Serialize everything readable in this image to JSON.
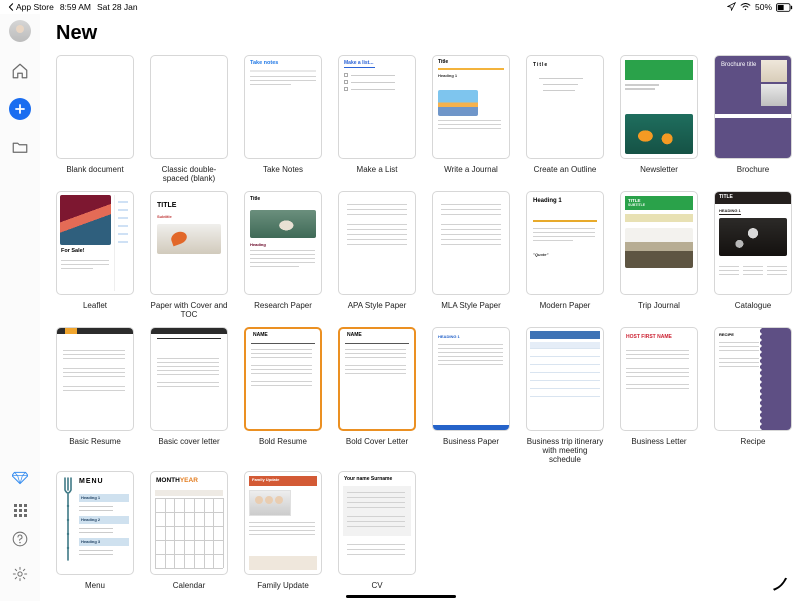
{
  "status": {
    "backApp": "App Store",
    "time": "8:59 AM",
    "date": "Sat 28 Jan",
    "batteryPct": "50%"
  },
  "page": {
    "title": "New"
  },
  "templates": [
    {
      "label": "Blank document"
    },
    {
      "label": "Classic double-spaced (blank)"
    },
    {
      "label": "Take Notes"
    },
    {
      "label": "Make a List"
    },
    {
      "label": "Write a Journal"
    },
    {
      "label": "Create an Outline"
    },
    {
      "label": "Newsletter"
    },
    {
      "label": "Brochure"
    },
    {
      "label": "Leaflet"
    },
    {
      "label": "Paper with Cover and TOC"
    },
    {
      "label": "Research Paper"
    },
    {
      "label": "APA Style Paper"
    },
    {
      "label": "MLA Style Paper"
    },
    {
      "label": "Modern Paper"
    },
    {
      "label": "Trip Journal"
    },
    {
      "label": "Catalogue"
    },
    {
      "label": "Basic Resume"
    },
    {
      "label": "Basic cover letter"
    },
    {
      "label": "Bold Resume"
    },
    {
      "label": "Bold Cover Letter"
    },
    {
      "label": "Business Paper"
    },
    {
      "label": "Business trip itinerary with meeting schedule"
    },
    {
      "label": "Business Letter"
    },
    {
      "label": "Recipe"
    },
    {
      "label": "Menu"
    },
    {
      "label": "Calendar"
    },
    {
      "label": "Family Update"
    },
    {
      "label": "CV"
    }
  ],
  "thumbText": {
    "takeNotes": "Take notes",
    "makeList": "Make a list...",
    "journalTitle": "Title",
    "journalHeading": "Heading 1",
    "outline": "Title",
    "brochure": "Brochure title",
    "leaflet": "For Sale!",
    "coverTitle": "TITLE",
    "coverSubtitle": "Subtitle",
    "researchTitle": "Title",
    "researchHeading": "Heading",
    "modernTitle": "Heading 1",
    "modernQuote": "\"Quote\"",
    "tripTitle": "TITLE",
    "tripSub": "SUBTITLE",
    "catalogueTitle": "TITLE",
    "catalogueHeading": "HEADING 1",
    "boldName": "NAME",
    "bpaperHeading": "HEADING 1",
    "bletterName": "HOST FIRST NAME",
    "recipeTitle": "RECIPE",
    "menuTitle": "MENU",
    "menuSec1": "Heading 1",
    "menuSec2": "Heading 2",
    "menuSec3": "Heading 3",
    "calMonth": "MONTH",
    "calYear": "YEAR",
    "family": "Family Update",
    "cvFirst": "Your name",
    "cvLast": "Surname"
  }
}
